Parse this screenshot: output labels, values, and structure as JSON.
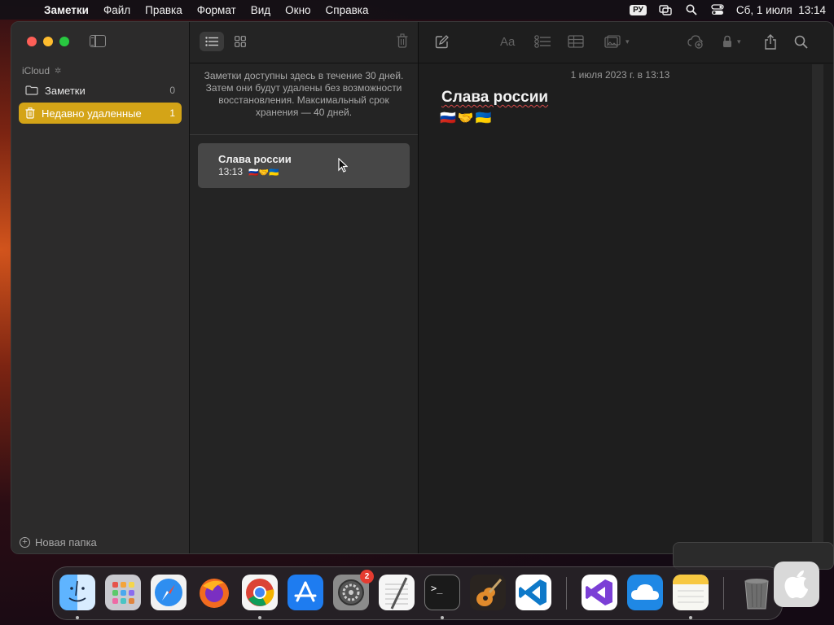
{
  "menubar": {
    "app_name": "Заметки",
    "menus": [
      "Файл",
      "Правка",
      "Формат",
      "Вид",
      "Окно",
      "Справка"
    ],
    "input_source": "РУ",
    "datetime": "Сб, 1 июля  13:14"
  },
  "sidebar": {
    "account_label": "iCloud",
    "folders": [
      {
        "label": "Заметки",
        "count": "0",
        "icon": "folder-icon"
      },
      {
        "label": "Недавно удаленные",
        "count": "1",
        "icon": "trash-icon",
        "selected": true
      }
    ],
    "new_folder_label": "Новая папка"
  },
  "notes_list": {
    "notice": "Заметки доступны здесь в течение 30 дней. Затем они будут удалены без возможности восстановления. Максимальный срок хранения — 40 дней.",
    "notes": [
      {
        "title": "Слава россии",
        "time": "13:13",
        "preview": "🇷🇺🤝🇺🇦"
      }
    ]
  },
  "editor": {
    "date": "1 июля 2023 г. в 13:13",
    "title": "Слава россии",
    "body_emoji": "🇷🇺🤝🇺🇦"
  },
  "dock": {
    "apps": [
      "Finder",
      "Launchpad",
      "Safari",
      "Firefox",
      "Chrome",
      "App Store",
      "System Settings",
      "TextEdit",
      "Terminal",
      "GarageBand",
      "VS Code",
      "Visual Studio",
      "iCloud Drive",
      "Notes",
      "Trash"
    ],
    "settings_badge": "2"
  },
  "colors": {
    "accent": "#d4a417",
    "window_bg": "#1e1e1e",
    "sidebar_bg": "#2c2b2b"
  }
}
